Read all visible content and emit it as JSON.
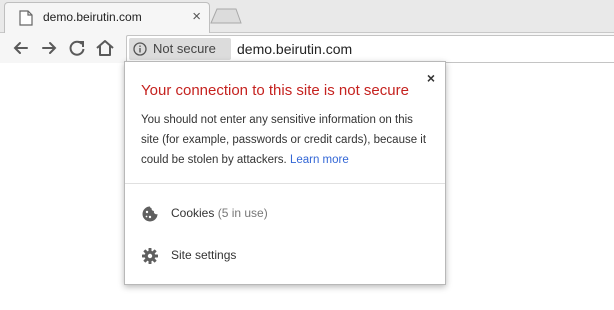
{
  "tab": {
    "title": "demo.beirutin.com",
    "close_icon": "×"
  },
  "omnibox": {
    "security_chip": "Not secure",
    "url": "demo.beirutin.com"
  },
  "popup": {
    "close_icon": "×",
    "title": "Your connection to this site is not secure",
    "description": "You should not enter any sensitive information on this site (for example, passwords or credit cards), because it could be stolen by attackers.",
    "learn_more": "Learn more",
    "cookies_label": "Cookies",
    "cookies_count": "(5 in use)",
    "site_settings_label": "Site settings"
  },
  "colors": {
    "warning_red": "#c5221f",
    "link_blue": "#3367d6"
  },
  "icons": {
    "tab": "page-icon",
    "back": "back-arrow-icon",
    "forward": "forward-arrow-icon",
    "reload": "reload-icon",
    "home": "home-icon",
    "info": "info-icon",
    "cookies": "cookie-icon",
    "settings": "gear-icon"
  }
}
